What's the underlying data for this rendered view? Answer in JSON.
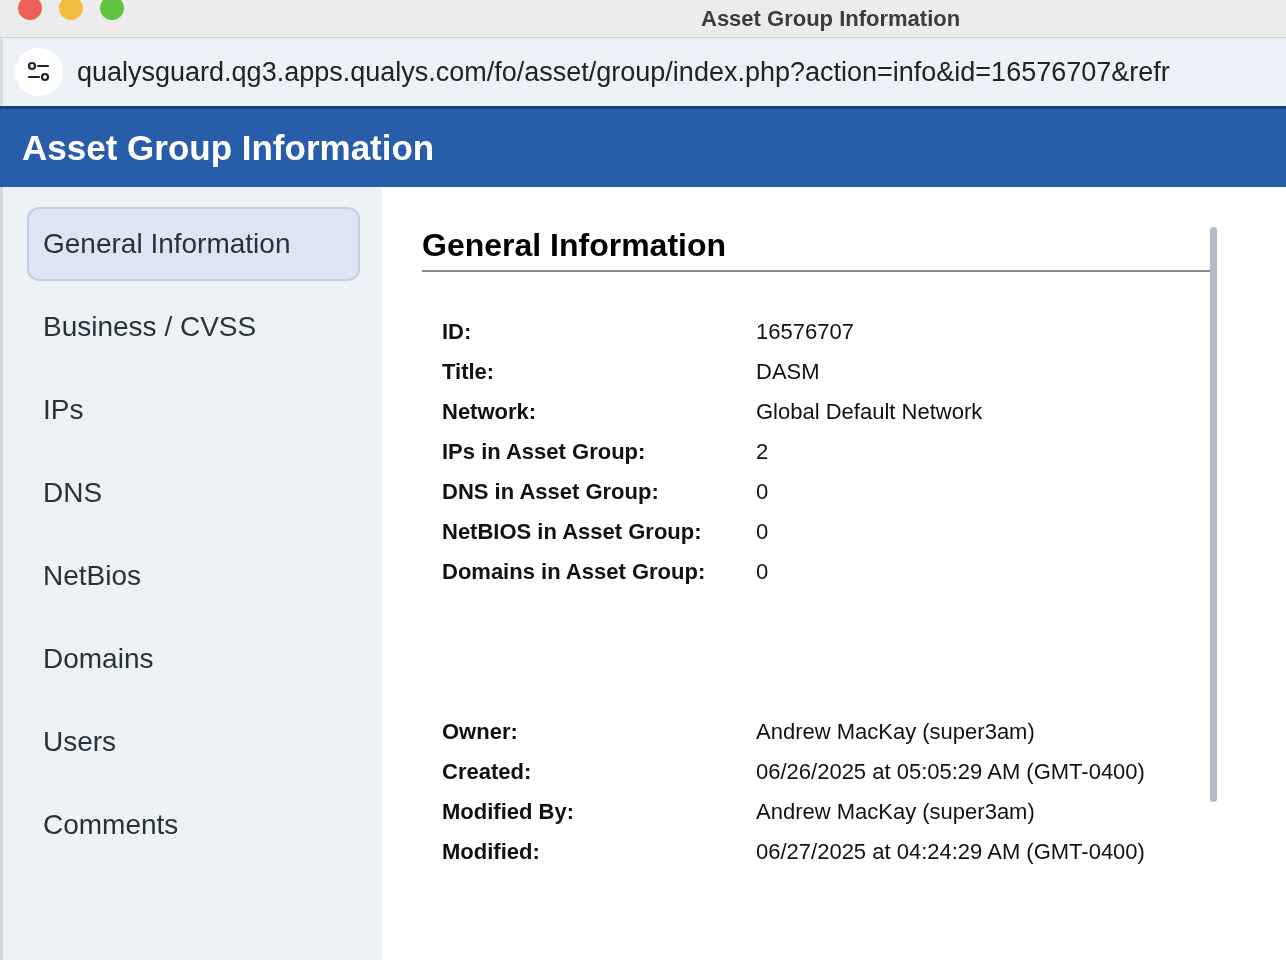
{
  "window": {
    "title": "Asset Group Information"
  },
  "address_bar": {
    "url": "qualysguard.qg3.apps.qualys.com/fo/asset/group/index.php?action=info&id=16576707&refr"
  },
  "header": {
    "title": "Asset Group Information"
  },
  "sidebar": {
    "items": [
      {
        "label": "General Information",
        "selected": true
      },
      {
        "label": "Business / CVSS",
        "selected": false
      },
      {
        "label": "IPs",
        "selected": false
      },
      {
        "label": "DNS",
        "selected": false
      },
      {
        "label": "NetBios",
        "selected": false
      },
      {
        "label": "Domains",
        "selected": false
      },
      {
        "label": "Users",
        "selected": false
      },
      {
        "label": "Comments",
        "selected": false
      }
    ]
  },
  "content": {
    "title": "General Information",
    "details": [
      {
        "label": "ID:",
        "value": "16576707"
      },
      {
        "label": "Title:",
        "value": "DASM"
      },
      {
        "label": "Network:",
        "value": "Global Default Network"
      },
      {
        "label": "IPs in Asset Group:",
        "value": "2"
      },
      {
        "label": "DNS in Asset Group:",
        "value": "0"
      },
      {
        "label": "NetBIOS in Asset Group:",
        "value": "0"
      },
      {
        "label": "Domains in Asset Group:",
        "value": "0"
      }
    ],
    "audit": [
      {
        "label": "Owner:",
        "value": "Andrew MacKay (super3am)"
      },
      {
        "label": "Created:",
        "value": "06/26/2025 at 05:05:29 AM (GMT-0400)"
      },
      {
        "label": "Modified By:",
        "value": "Andrew MacKay (super3am)"
      },
      {
        "label": "Modified:",
        "value": "06/27/2025 at 04:24:29 AM (GMT-0400)"
      }
    ]
  }
}
